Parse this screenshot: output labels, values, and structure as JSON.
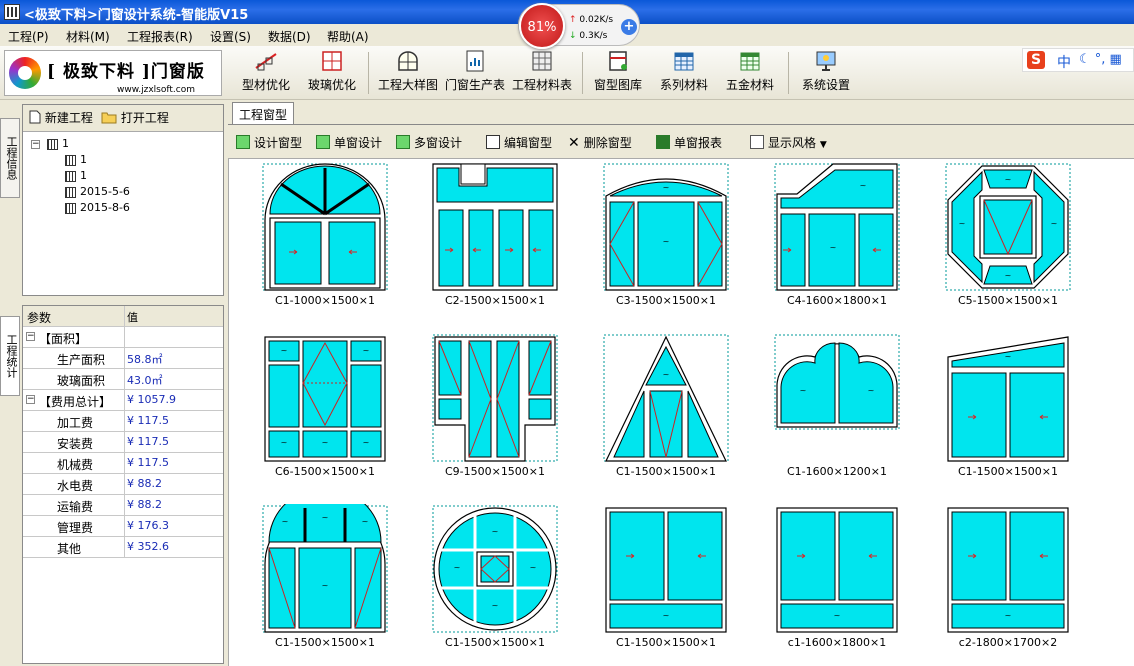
{
  "window": {
    "title": "<极致下料>门窗设计系统-智能版V15"
  },
  "menu": [
    "工程(P)",
    "材料(M)",
    "工程报表(R)",
    "设置(S)",
    "数据(D)",
    "帮助(A)"
  ],
  "logo": {
    "brand": "[ 极致下料 ]门窗版",
    "url": "www.jzxlsoft.com"
  },
  "toolbar": {
    "items": [
      "型材优化",
      "玻璃优化",
      "工程大样图",
      "门窗生产表",
      "工程材料表",
      "窗型图库",
      "系列材料",
      "五金材料",
      "系统设置"
    ]
  },
  "net_widget": {
    "percent": "81%",
    "upload": "0.02K/s",
    "download": "0.3K/s"
  },
  "ime": {
    "label": "中"
  },
  "side_tabs": [
    "工程信息",
    "工程统计"
  ],
  "project_actions": {
    "new": "新建工程",
    "open": "打开工程"
  },
  "tree": {
    "root": "1",
    "children": [
      "1",
      "1",
      "2015-5-6",
      "2015-8-6"
    ]
  },
  "props": {
    "col_param": "参数",
    "col_value": "值",
    "rows": [
      {
        "k": "【面积】",
        "v": "",
        "group": true
      },
      {
        "k": "生产面积",
        "v": "58.8㎡"
      },
      {
        "k": "玻璃面积",
        "v": "43.0㎡"
      },
      {
        "k": "【费用总计】",
        "v": "¥ 1057.9",
        "group": true
      },
      {
        "k": "加工费",
        "v": "¥ 117.5"
      },
      {
        "k": "安装费",
        "v": "¥ 117.5"
      },
      {
        "k": "机械费",
        "v": "¥ 117.5"
      },
      {
        "k": "水电费",
        "v": "¥ 88.2"
      },
      {
        "k": "运输费",
        "v": "¥ 88.2"
      },
      {
        "k": "管理费",
        "v": "¥ 176.3"
      },
      {
        "k": "其他",
        "v": "¥ 352.6"
      }
    ]
  },
  "main": {
    "tab": "工程窗型",
    "actions": [
      "设计窗型",
      "单窗设计",
      "多窗设计",
      "编辑窗型",
      "删除窗型",
      "单窗报表",
      "显示风格"
    ]
  },
  "windows": [
    {
      "caption": "C1-1000×1500×1",
      "shape": "arch-top"
    },
    {
      "caption": "C2-1500×1500×1",
      "shape": "notch-top"
    },
    {
      "caption": "C3-1500×1500×1",
      "shape": "segment-top"
    },
    {
      "caption": "C4-1600×1800×1",
      "shape": "slope-top"
    },
    {
      "caption": "C5-1500×1500×1",
      "shape": "octagon"
    },
    {
      "caption": "C6-1500×1500×1",
      "shape": "grid"
    },
    {
      "caption": "C9-1500×1500×1",
      "shape": "t-shape"
    },
    {
      "caption": "C1-1500×1500×1",
      "shape": "triangle"
    },
    {
      "caption": "C1-1600×1200×1",
      "shape": "cloud"
    },
    {
      "caption": "C1-1500×1500×1",
      "shape": "slant-top"
    },
    {
      "caption": "C1-1500×1500×1",
      "shape": "round-top"
    },
    {
      "caption": "C1-1500×1500×1",
      "shape": "circle"
    },
    {
      "caption": "C1-1500×1500×1",
      "shape": "slider"
    },
    {
      "caption": "c1-1600×1800×1",
      "shape": "slider"
    },
    {
      "caption": "c2-1800×1700×2",
      "shape": "slider"
    }
  ],
  "colors": {
    "glass": "#00e5ee",
    "frame": "#ffffff",
    "accent": "#0a58d8"
  }
}
